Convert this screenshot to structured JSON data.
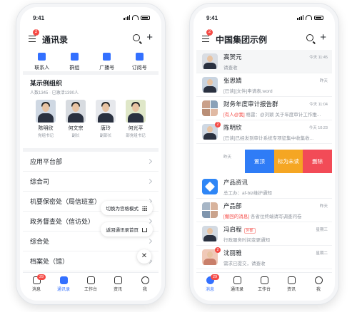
{
  "left": {
    "time": "9:41",
    "menu_badge": "2",
    "title": "通讯录",
    "quick_actions": [
      {
        "label": "联系人",
        "icon": "contacts-icon"
      },
      {
        "label": "群组",
        "icon": "group-icon"
      },
      {
        "label": "广播号",
        "icon": "broadcast-icon"
      },
      {
        "label": "订阅号",
        "icon": "subscription-icon"
      }
    ],
    "org": {
      "name": "某示例组织",
      "sub": "人数1345 · 已激活1390人",
      "leaders": [
        {
          "name": "陈明欣",
          "title": "党组书记"
        },
        {
          "name": "何文宗",
          "title": "副长"
        },
        {
          "name": "唐玲",
          "title": "副部长"
        },
        {
          "name": "何光平",
          "title": "部党组书记"
        }
      ]
    },
    "departments": [
      "应用平台部",
      "综合司",
      "机要保密处（局信班室）",
      "政务督查处（信访处）",
      "综合处",
      "档案处（馆）"
    ],
    "floating": {
      "grid_mode": "切换为宫格模式",
      "back_home": "返回通讯录首页",
      "close": "✕"
    },
    "tabs": [
      {
        "label": "消息",
        "badge": "29"
      },
      {
        "label": "通讯录",
        "badge": ""
      },
      {
        "label": "工作台",
        "badge": ""
      },
      {
        "label": "资讯",
        "badge": ""
      },
      {
        "label": "我",
        "badge": ""
      }
    ]
  },
  "right": {
    "time": "9:41",
    "menu_badge": "2",
    "title": "中国集团示例",
    "chats": [
      {
        "name": "高贺元",
        "time": "今天 11:45",
        "msg": "请查收",
        "prefix": "",
        "badge": "",
        "avatar": "person"
      },
      {
        "name": "张思婧",
        "time": "昨天",
        "msg": "[已读][文件]申请表.word",
        "prefix": "",
        "badge": "",
        "avatar": "person"
      },
      {
        "name": "财务年度审计报告群",
        "time": "今天 11:04",
        "msg": "格雷：@刘颖 关于年度审计工作推...",
        "prefix": "[有人@我]",
        "badge": "",
        "avatar": "group"
      },
      {
        "name": "陈明欣",
        "time": "今天 10:23",
        "msg": "[已读]已经发到审计系统专项征集中收集收...",
        "prefix": "",
        "badge": "2",
        "avatar": "person"
      },
      {
        "name": "产品资讯",
        "time": "",
        "msg": "总工办：af-biz维护通知",
        "prefix": "",
        "badge": "",
        "avatar": "app"
      },
      {
        "name": "产品部",
        "time": "昨天",
        "msg": "各省位终端请写调查问卷",
        "prefix": "[撤回的消息]",
        "badge": "",
        "avatar": "group"
      },
      {
        "name": "冯启程",
        "time": "星期三",
        "msg": "行政服务时间变更通知",
        "prefix": "",
        "badge": "",
        "avatar": "person",
        "tag": "外部"
      },
      {
        "name": "沈丽雅",
        "time": "星期二",
        "msg": "需求已提交，请查收",
        "prefix": "",
        "badge": "2",
        "avatar": "person"
      }
    ],
    "swipe": {
      "time": "昨天",
      "actions": [
        {
          "label": "置顶",
          "color": "#2f7cf6"
        },
        {
          "label": "标为未读",
          "color": "#f5a623"
        },
        {
          "label": "删除",
          "color": "#f24b57"
        }
      ]
    },
    "tabs": [
      {
        "label": "消息",
        "badge": "29"
      },
      {
        "label": "通讯录",
        "badge": ""
      },
      {
        "label": "工作台",
        "badge": ""
      },
      {
        "label": "资讯",
        "badge": ""
      },
      {
        "label": "我",
        "badge": ""
      }
    ]
  },
  "colors": {
    "accent": "#3370ff",
    "badge": "#f54a45"
  }
}
